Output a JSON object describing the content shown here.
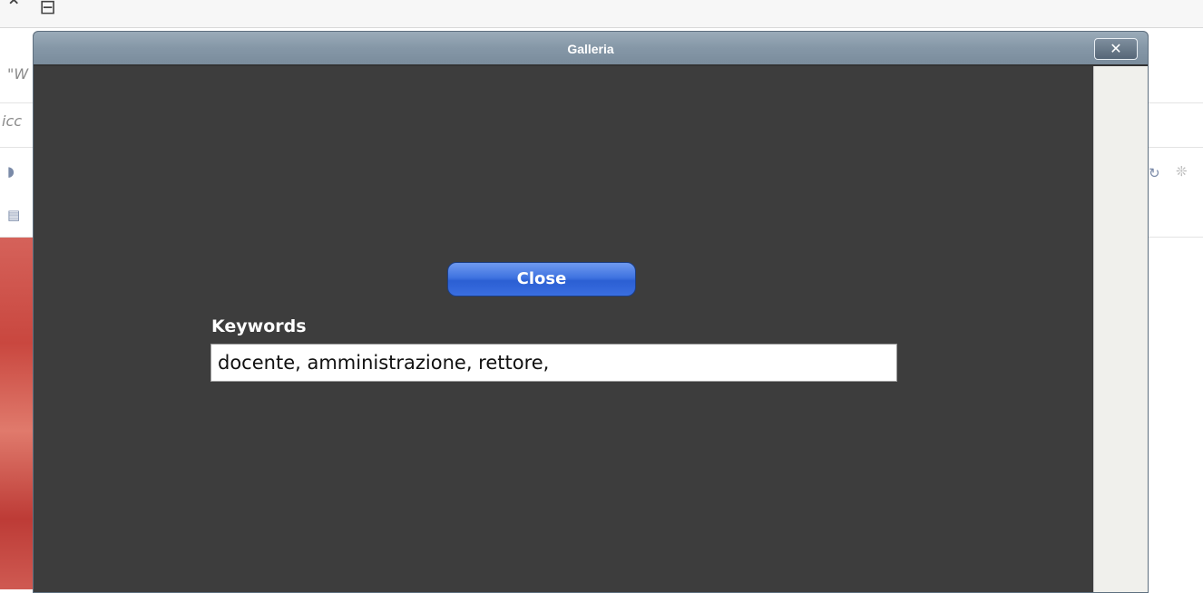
{
  "background": {
    "fragments": [
      "\"W",
      "icc"
    ]
  },
  "dialog": {
    "title": "Galleria",
    "close_icon": "✕",
    "close_button_label": "Close",
    "keywords_label": "Keywords",
    "keywords_value": "docente, amministrazione, rettore,"
  },
  "colors": {
    "dialog_bg": "#3d3d3d",
    "titlebar": "#8597a7",
    "close_button": "#3a6ee0",
    "scrollbar_track": "#f0f0ec"
  }
}
